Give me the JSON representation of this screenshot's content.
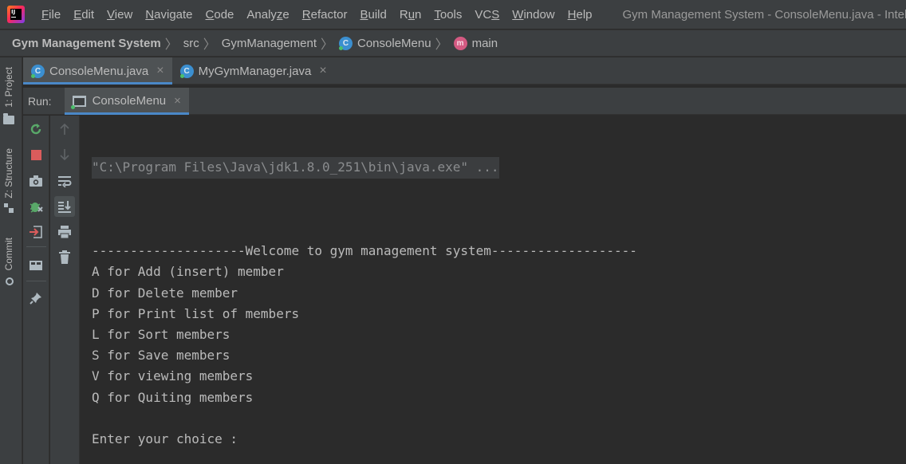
{
  "menubar": {
    "items": [
      {
        "label": "File",
        "u": "F",
        "rest": "ile"
      },
      {
        "label": "Edit",
        "u": "E",
        "rest": "dit"
      },
      {
        "label": "View",
        "u": "V",
        "rest": "iew"
      },
      {
        "label": "Navigate",
        "u": "N",
        "rest": "avigate"
      },
      {
        "label": "Code",
        "u": "C",
        "rest": "ode"
      },
      {
        "label": "Analyze",
        "pre": "Analy",
        "u": "z",
        "rest": "e"
      },
      {
        "label": "Refactor",
        "u": "R",
        "rest": "efactor"
      },
      {
        "label": "Build",
        "u": "B",
        "rest": "uild"
      },
      {
        "label": "Run",
        "pre": "R",
        "u": "u",
        "rest": "n"
      },
      {
        "label": "Tools",
        "u": "T",
        "rest": "ools"
      },
      {
        "label": "VCS",
        "pre": "VC",
        "u": "S",
        "rest": ""
      },
      {
        "label": "Window",
        "u": "W",
        "rest": "indow"
      },
      {
        "label": "Help",
        "u": "H",
        "rest": "elp"
      }
    ],
    "window_title": "Gym Management System - ConsoleMenu.java - IntelliJ IDEA"
  },
  "logo": {
    "text": "IJ"
  },
  "breadcrumb": {
    "project": "Gym Management System",
    "src": "src",
    "package": "GymManagement",
    "class_icon": "C",
    "class": "ConsoleMenu",
    "method_icon": "m",
    "method": "main",
    "separator": "〉"
  },
  "left_strip": {
    "project": "1: Project",
    "structure": "Z: Structure",
    "commit": "Commit"
  },
  "editor_tabs": [
    {
      "label": "ConsoleMenu.java",
      "icon": "C",
      "active": true
    },
    {
      "label": "MyGymManager.java",
      "icon": "C",
      "active": false
    }
  ],
  "run": {
    "label": "Run:",
    "tab": "ConsoleMenu",
    "close": "×"
  },
  "console": {
    "command": "\"C:\\Program Files\\Java\\jdk1.8.0_251\\bin\\java.exe\" ...",
    "lines": [
      "",
      "--------------------Welcome to gym management system-------------------",
      "A for Add (insert) member",
      "D for Delete member",
      "P for Print list of members",
      "L for Sort members",
      "S for Save members",
      "V for viewing members",
      "Q for Quiting members",
      "",
      "Enter your choice :"
    ]
  },
  "icons": {
    "rerun": "rerun-icon",
    "stop": "stop-icon",
    "dump": "camera-icon",
    "debug": "bug-icon",
    "exit": "exit-icon",
    "layout": "layout-icon",
    "pin": "pin-icon",
    "up": "arrow-up-icon",
    "down": "arrow-down-icon",
    "wrap": "soft-wrap-icon",
    "scroll": "scroll-to-end-icon",
    "print": "print-icon",
    "trash": "trash-icon"
  },
  "colors": {
    "accent": "#4a88c7",
    "run_green": "#59a869",
    "stop_red": "#db5c5c",
    "background": "#2b2b2b",
    "panel": "#3c3f41"
  }
}
